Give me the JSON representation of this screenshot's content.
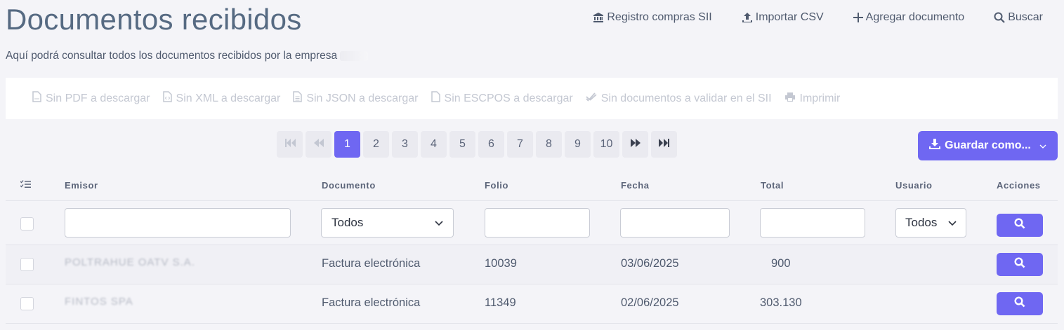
{
  "header": {
    "title": "Documentos recibidos",
    "subtitle": "Aquí podrá consultar todos los documentos recibidos por la empresa"
  },
  "top_actions": [
    {
      "label": "Registro compras SII",
      "icon": "bank-icon"
    },
    {
      "label": "Importar CSV",
      "icon": "upload-icon"
    },
    {
      "label": "Agregar documento",
      "icon": "plus-icon"
    },
    {
      "label": "Buscar",
      "icon": "search-icon"
    }
  ],
  "toolbar": {
    "pdf": "Sin PDF a descargar",
    "xml": "Sin XML a descargar",
    "json": "Sin JSON a descargar",
    "escpos": "Sin ESCPOS a descargar",
    "validate": "Sin documentos a validar en el SII",
    "print": "Imprimir"
  },
  "pager": {
    "pages": [
      "1",
      "2",
      "3",
      "4",
      "5",
      "6",
      "7",
      "8",
      "9",
      "10"
    ],
    "current": "1"
  },
  "save_button": "Guardar como...",
  "table": {
    "headers": {
      "emisor": "Emisor",
      "documento": "Documento",
      "folio": "Folio",
      "fecha": "Fecha",
      "total": "Total",
      "usuario": "Usuario",
      "acciones": "Acciones"
    },
    "filters": {
      "documento": "Todos",
      "usuario": "Todos"
    },
    "rows": [
      {
        "emisor": "POLTRAHUE OATV S.A.",
        "documento": "Factura electrónica",
        "folio": "10039",
        "fecha": "03/06/2025",
        "total": "900"
      },
      {
        "emisor": "FINTOS SPA",
        "documento": "Factura electrónica",
        "folio": "11349",
        "fecha": "02/06/2025",
        "total": "303.130"
      }
    ]
  },
  "colors": {
    "accent": "#6f67f2",
    "title": "#566a82",
    "background": "#f4f4f8"
  }
}
